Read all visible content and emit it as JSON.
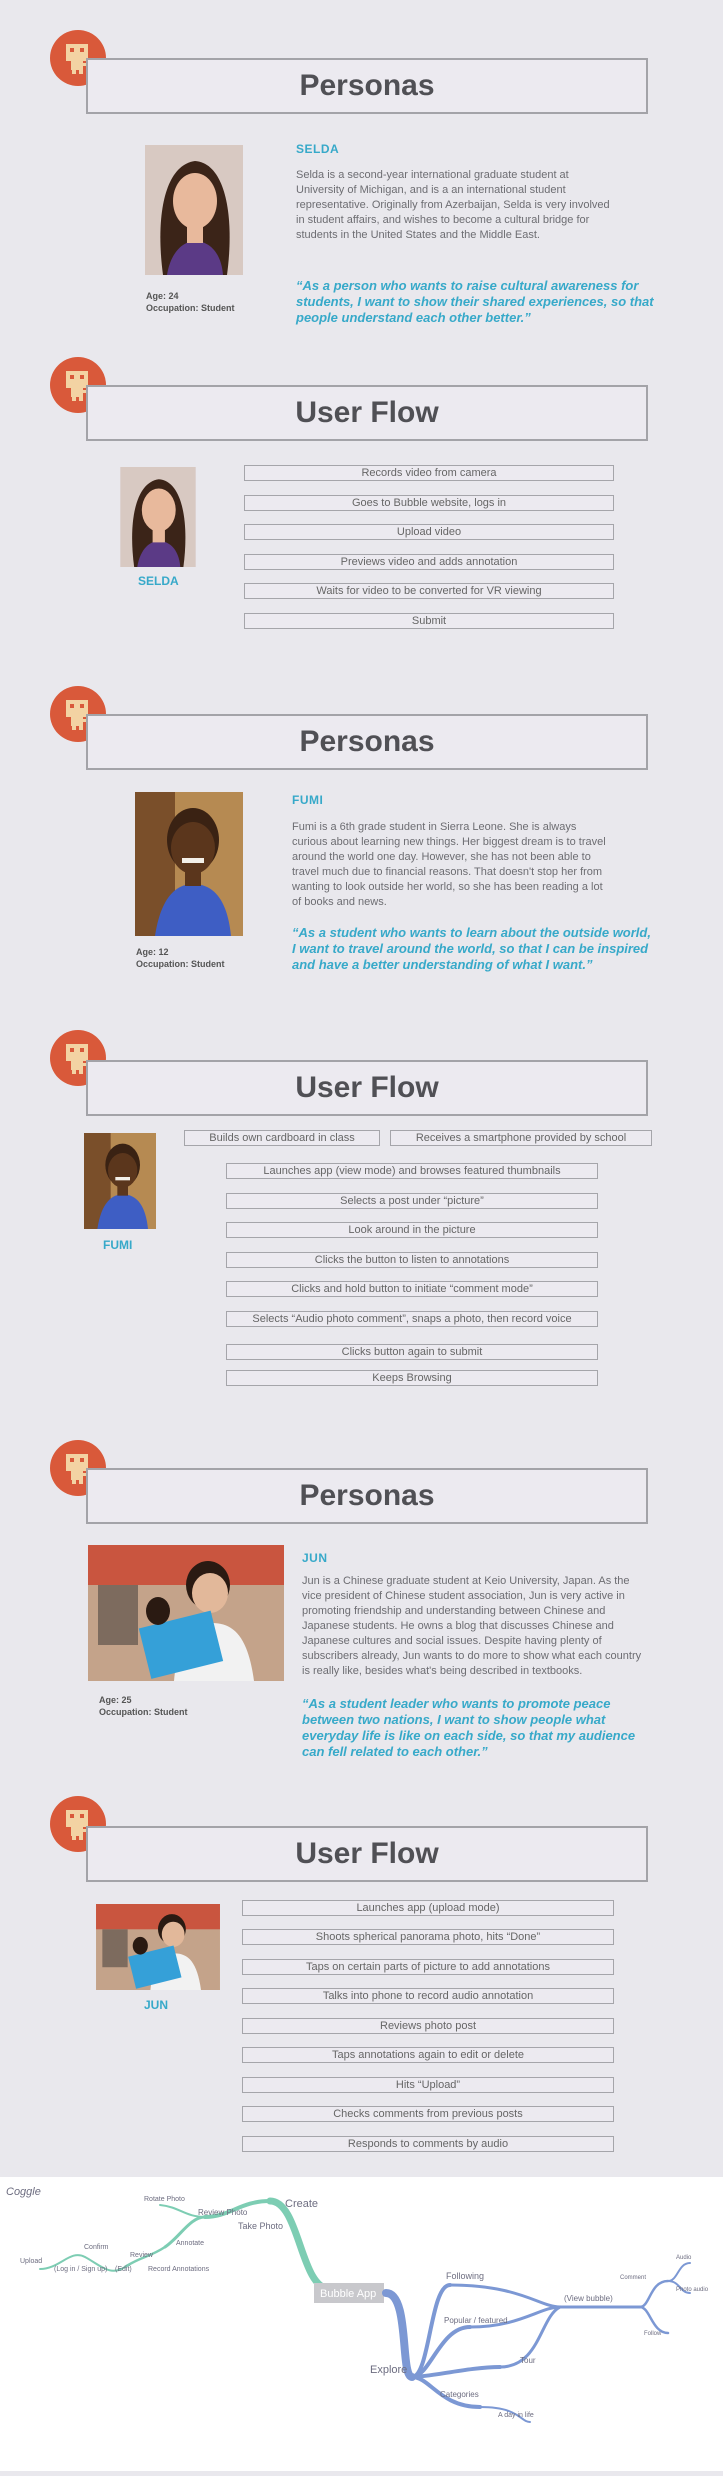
{
  "sections": {
    "personas_title": "Personas",
    "userflow_title": "User Flow"
  },
  "selda": {
    "name": "SELDA",
    "description": "Selda is a second-year international graduate student at University of Michigan, and is a an international student representative. Originally from Azerbaijan, Selda is very involved in student affairs, and wishes to become a cultural bridge for students in the United States and the Middle East.",
    "quote": "“As a person who wants to raise cultural awareness for students, I want to show their shared experiences, so that people understand each other better.”",
    "age": "Age: 24",
    "occupation": "Occupation: Student",
    "flow": [
      "Records video from camera",
      "Goes to Bubble website, logs in",
      "Upload video",
      "Previews video and adds annotation",
      "Waits for video to be converted for VR viewing",
      "Submit"
    ]
  },
  "fumi": {
    "name": "FUMI",
    "description": "Fumi is a 6th grade student in Sierra Leone. She is always curious about learning new things. Her biggest dream is to travel around the world one day. However, she has not been able to travel much due to financial reasons. That doesn't stop her from wanting to look outside her world, so she has been reading a lot of books and news.",
    "quote": "“As a student who wants to learn about the outside world, I want to travel around the world, so that I can be inspired and have a better understanding of what I want.”",
    "age": "Age: 12",
    "occupation": "Occupation: Student",
    "flow_top": [
      "Builds own cardboard in class",
      "Receives a smartphone provided by school"
    ],
    "flow": [
      "Launches app (view mode) and browses featured thumbnails",
      "Selects a post under “picture”",
      "Look around in the picture",
      "Clicks the button to listen to annotations",
      "Clicks and hold button to initiate “comment mode”",
      "Selects “Audio photo comment”, snaps a photo, then record voice",
      "Clicks button again to submit",
      "Keeps Browsing"
    ]
  },
  "jun": {
    "name": "JUN",
    "description": "Jun is a Chinese graduate student at Keio University, Japan. As the vice president of Chinese student association, Jun is very active in promoting friendship and understanding between Chinese and Japanese students. He owns a blog that discusses Chinese and Japanese cultures and social issues. Despite having plenty of subscribers already, Jun wants to do more to show what each country is really like, besides what's being described in textbooks.",
    "quote": "“As a student leader who wants to promote peace between two nations, I want to show people what everyday life is like on each side, so that my audience can fell related to each other.”",
    "age": "Age: 25",
    "occupation": "Occupation: Student",
    "flow": [
      "Launches app (upload mode)",
      "Shoots spherical panorama photo, hits “Done”",
      "Taps on certain parts of picture to add annotations",
      "Talks into phone to record audio annotation",
      "Reviews photo post",
      "Taps annotations again to edit or delete",
      "Hits “Upload”",
      "Checks comments from previous posts",
      "Responds to comments by audio"
    ]
  },
  "mindmap": {
    "brand": "Coggle",
    "center": "Bubble App",
    "create": "Create",
    "review_photo": "Review Photo",
    "rotate_photo": "Rotate Photo",
    "take_photo": "Take Photo",
    "annotate": "Annotate",
    "review": "Review",
    "record_annotations": "Record Annotations",
    "confirm": "Confirm",
    "edit": "(Edit)",
    "upload": "Upload",
    "login": "(Log in / Sign up)",
    "explore": "Explore",
    "following": "Following",
    "popular": "Popular / featured",
    "view_bubble": "(View bubble)",
    "comment": "Comment",
    "audio": "Audio",
    "photo_audio": "Photo audio",
    "follow": "Follow",
    "tour": "Tour",
    "categories": "Categories",
    "day_in_life": "A day in life"
  },
  "colors": {
    "accent": "#37a9c9",
    "badge": "#d9593a",
    "create_branch": "#7dcdb3",
    "explore_branch": "#7c98d4"
  }
}
